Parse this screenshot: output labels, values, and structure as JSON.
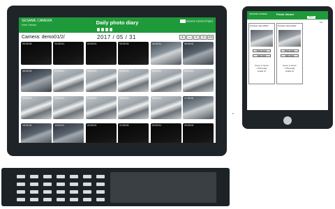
{
  "monitor": {
    "header": {
      "brand": "SESAME CAMERA",
      "brand_sub": "Web Viewer",
      "title": "Daily photo diary",
      "tabs": [
        "",
        "",
        "",
        ""
      ],
      "right_text": "Sesame Camera Project"
    },
    "camera_label": "Camera: demo01/2/",
    "date": "2017 / 05 / 31",
    "nav_buttons": [
      "+",
      "−",
      "<",
      ">",
      ">>"
    ],
    "thumbnails": [
      {
        "time": "00:00:01",
        "tone": "night"
      },
      {
        "time": "01:00:01",
        "tone": "night"
      },
      {
        "time": "02:00:01",
        "tone": "night"
      },
      {
        "time": "03:00:01",
        "tone": "night"
      },
      {
        "time": "04:00:01",
        "tone": "dawn"
      },
      {
        "time": "05:00:01",
        "tone": "dusk"
      },
      {
        "time": "06:00:01",
        "tone": "dusk"
      },
      {
        "time": "07:00:01",
        "tone": "day"
      },
      {
        "time": "08:00:01",
        "tone": "day"
      },
      {
        "time": "09:00:01",
        "tone": "day"
      },
      {
        "time": "10:00:01",
        "tone": "day"
      },
      {
        "time": "11:00:01",
        "tone": "day"
      },
      {
        "time": "12:00:01",
        "tone": "day"
      },
      {
        "time": "13:00:01",
        "tone": "day"
      },
      {
        "time": "14:00:01",
        "tone": "day"
      },
      {
        "time": "15:00:01",
        "tone": "day"
      },
      {
        "time": "16:00:01",
        "tone": "day"
      },
      {
        "time": "17:00:01",
        "tone": "dawn"
      },
      {
        "time": "18:00:01",
        "tone": "dusk"
      },
      {
        "time": "19:00:01",
        "tone": "dusk"
      },
      {
        "time": "20:00:01",
        "tone": "night"
      },
      {
        "time": "21:00:01",
        "tone": "night"
      },
      {
        "time": "22:00:01",
        "tone": "night"
      },
      {
        "time": "23:00:01",
        "tone": "night"
      }
    ]
  },
  "tablet": {
    "header": {
      "brand": "SESAME CAMERA",
      "title": "Photo Viewer",
      "select_label": "Select"
    },
    "page_label": "1/2",
    "cards": [
      {
        "camera": "Camera: demo01/2/",
        "buttons": [
          "Photo viewer",
          "Daily photo"
        ],
        "caption": [
          "Seven to Seven",
          "1 Photo/day",
          "update 1h"
        ]
      },
      {
        "camera": "Camera: demo01/2/",
        "buttons": [
          "Photo viewer",
          "Daily photo"
        ],
        "caption": [
          "Seven to Seven",
          "1 Photo/day",
          "update 1h"
        ]
      }
    ]
  },
  "colors": {
    "accent": "#1f9a3a",
    "device_frame": "#1f2429"
  }
}
